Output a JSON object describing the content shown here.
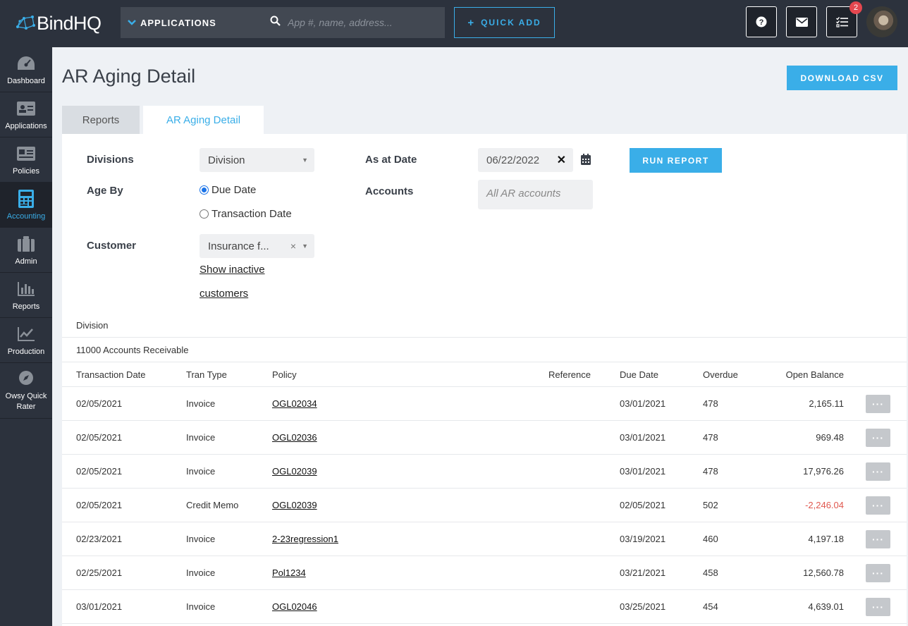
{
  "brand": {
    "name": "BindHQ",
    "accent": "#3aaee8",
    "dark": "#2c323d"
  },
  "topbar": {
    "app_select_label": "APPLICATIONS",
    "search_placeholder": "App #, name, address...",
    "quick_add_label": "QUICK ADD",
    "tasks_badge": "2",
    "icons": [
      "help-icon",
      "mail-icon",
      "tasks-icon"
    ]
  },
  "sidebar": {
    "items": [
      {
        "label": "Dashboard",
        "icon": "dashboard-icon",
        "active": false
      },
      {
        "label": "Applications",
        "icon": "applications-icon",
        "active": false
      },
      {
        "label": "Policies",
        "icon": "policies-icon",
        "active": false
      },
      {
        "label": "Accounting",
        "icon": "calculator-icon",
        "active": true
      },
      {
        "label": "Admin",
        "icon": "briefcase-icon",
        "active": false
      },
      {
        "label": "Reports",
        "icon": "bar-chart-icon",
        "active": false
      },
      {
        "label": "Production",
        "icon": "line-chart-icon",
        "active": false
      },
      {
        "label": "Owsy Quick Rater",
        "icon": "compass-icon",
        "active": false
      }
    ]
  },
  "page": {
    "title": "AR Aging Detail",
    "download_label": "DOWNLOAD CSV",
    "tabs": [
      {
        "label": "Reports"
      },
      {
        "label": "AR Aging Detail"
      }
    ]
  },
  "filters": {
    "divisions_label": "Divisions",
    "division_value": "Division",
    "age_by_label": "Age By",
    "age_options": [
      "Due Date",
      "Transaction Date"
    ],
    "age_selected": "Due Date",
    "customer_label": "Customer",
    "customer_value": "Insurance f...",
    "show_inactive_line1": "Show inactive",
    "show_inactive_line2": "customers",
    "as_at_label": "As at Date",
    "as_at_value": "06/22/2022",
    "accounts_label": "Accounts",
    "accounts_placeholder": "All AR accounts",
    "run_label": "RUN REPORT"
  },
  "table": {
    "group_division": "Division",
    "group_account": "11000 Accounts Receivable",
    "headers": {
      "transaction_date": "Transaction Date",
      "tran_type": "Tran Type",
      "policy": "Policy",
      "reference": "Reference",
      "due_date": "Due Date",
      "overdue": "Overdue",
      "open_balance": "Open Balance"
    },
    "rows": [
      {
        "transaction_date": "02/05/2021",
        "tran_type": "Invoice",
        "policy": "OGL02034",
        "reference": "",
        "due_date": "03/01/2021",
        "overdue": "478",
        "open_balance": "2,165.11",
        "more": "···"
      },
      {
        "transaction_date": "02/05/2021",
        "tran_type": "Invoice",
        "policy": "OGL02036",
        "reference": "",
        "due_date": "03/01/2021",
        "overdue": "478",
        "open_balance": "969.48",
        "more": "···"
      },
      {
        "transaction_date": "02/05/2021",
        "tran_type": "Invoice",
        "policy": "OGL02039",
        "reference": "",
        "due_date": "03/01/2021",
        "overdue": "478",
        "open_balance": "17,976.26",
        "more": "···"
      },
      {
        "transaction_date": "02/05/2021",
        "tran_type": "Credit Memo",
        "policy": "OGL02039",
        "reference": "",
        "due_date": "02/05/2021",
        "overdue": "502",
        "open_balance": "-2,246.04",
        "more": "···"
      },
      {
        "transaction_date": "02/23/2021",
        "tran_type": "Invoice",
        "policy": "2-23regression1",
        "reference": "",
        "due_date": "03/19/2021",
        "overdue": "460",
        "open_balance": "4,197.18",
        "more": "···"
      },
      {
        "transaction_date": "02/25/2021",
        "tran_type": "Invoice",
        "policy": "Pol1234",
        "reference": "",
        "due_date": "03/21/2021",
        "overdue": "458",
        "open_balance": "12,560.78",
        "more": "···"
      },
      {
        "transaction_date": "03/01/2021",
        "tran_type": "Invoice",
        "policy": "OGL02046",
        "reference": "",
        "due_date": "03/25/2021",
        "overdue": "454",
        "open_balance": "4,639.01",
        "more": "···"
      }
    ]
  }
}
